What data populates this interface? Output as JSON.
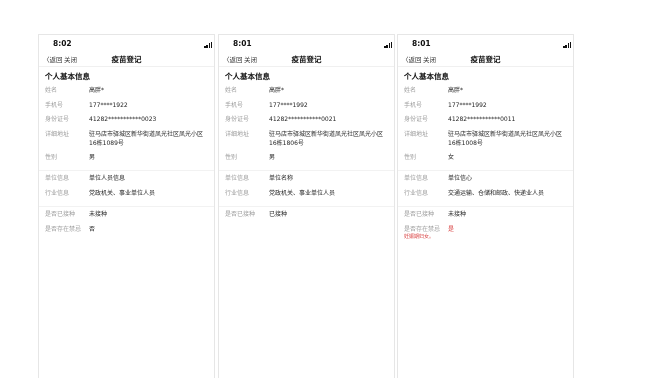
{
  "screens": [
    {
      "time": "8:02",
      "back_label": "〈返回",
      "close_label": "关闭",
      "title": "疫苗登记",
      "section_title": "个人基本信息",
      "fields": {
        "name": {
          "label": "姓名",
          "value": "高胖*"
        },
        "phone": {
          "label": "手机号",
          "value": "177****1922"
        },
        "id": {
          "label": "身份证号",
          "value": "41282***********0023"
        },
        "address": {
          "label": "详细地址",
          "value": "驻马店市驿城区新华街道凤光社区凤光小区16栋1089号"
        },
        "gender": {
          "label": "性别",
          "value": "男"
        },
        "org": {
          "label": "单位信息",
          "value": "单位人员信息"
        },
        "industry": {
          "label": "行业信息",
          "value": "党政机关、事业单位人员"
        },
        "vaccinated": {
          "label": "是否已接种",
          "value": "未接种"
        },
        "taboo": {
          "label": "是否存在禁忌",
          "value": "否"
        }
      }
    },
    {
      "time": "8:01",
      "back_label": "〈返回",
      "close_label": "关闭",
      "title": "疫苗登记",
      "section_title": "个人基本信息",
      "fields": {
        "name": {
          "label": "姓名",
          "value": "高胖*"
        },
        "phone": {
          "label": "手机号",
          "value": "177****1992"
        },
        "id": {
          "label": "身份证号",
          "value": "41282***********0021"
        },
        "address": {
          "label": "详细地址",
          "value": "驻马店市驿城区新华街道凤光社区凤光小区16栋1806号"
        },
        "gender": {
          "label": "性别",
          "value": "男"
        },
        "org": {
          "label": "单位信息",
          "value": "单位名称"
        },
        "industry": {
          "label": "行业信息",
          "value": "党政机关、事业单位人员"
        },
        "vaccinated": {
          "label": "是否已接种",
          "value": "已接种"
        }
      }
    },
    {
      "time": "8:01",
      "back_label": "〈返回",
      "close_label": "关闭",
      "title": "疫苗登记",
      "section_title": "个人基本信息",
      "fields": {
        "name": {
          "label": "姓名",
          "value": "高胖*"
        },
        "phone": {
          "label": "手机号",
          "value": "177****1992"
        },
        "id": {
          "label": "身份证号",
          "value": "41282***********0011"
        },
        "address": {
          "label": "详细地址",
          "value": "驻马店市驿城区新华街道凤光社区凤光小区16栋1008号"
        },
        "gender": {
          "label": "性别",
          "value": "女"
        },
        "org": {
          "label": "单位信息",
          "value": "单位信心"
        },
        "industry": {
          "label": "行业信息",
          "value": "交通运输、仓储和邮政、快递业人员"
        },
        "vaccinated": {
          "label": "是否已接种",
          "value": "未接种"
        },
        "taboo": {
          "label": "是否存在禁忌",
          "value": "是"
        },
        "taboo_note": "妊娠期妇女。"
      }
    }
  ],
  "colors": {
    "label": "#9a9a9a",
    "value": "#222222",
    "alert": "#d73a3a",
    "divider": "#f2f2f2"
  }
}
